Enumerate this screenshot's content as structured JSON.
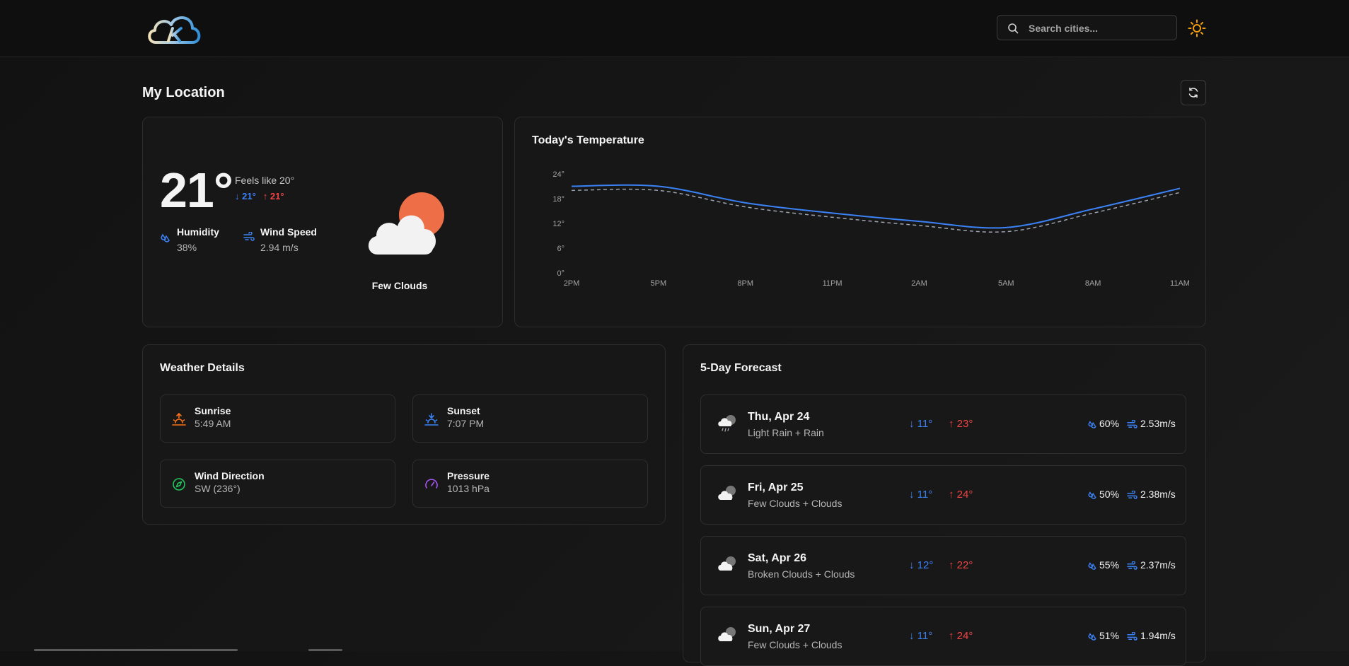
{
  "header": {
    "logo": "cloud-logo",
    "search_placeholder": "Search cities...",
    "theme_icon": "sun-icon"
  },
  "location": {
    "title": "My Location",
    "refresh_icon": "refresh-icon"
  },
  "current": {
    "temperature": "21°",
    "feels_like": "Feels like 20°",
    "min": "21°",
    "max": "21°",
    "humidity_label": "Humidity",
    "humidity_value": "38%",
    "wind_label": "Wind Speed",
    "wind_value": "2.94 m/s",
    "condition": "Few Clouds",
    "condition_icon": "few-clouds-icon"
  },
  "chart_data": {
    "type": "line",
    "title": "Today's Temperature",
    "categories": [
      "2PM",
      "5PM",
      "8PM",
      "11PM",
      "2AM",
      "5AM",
      "8AM",
      "11AM"
    ],
    "y_ticks": [
      "24°",
      "18°",
      "12°",
      "6°",
      "0°"
    ],
    "ylim": [
      0,
      24
    ],
    "grid": false,
    "series": [
      {
        "values": [
          21,
          21,
          17,
          14.5,
          12.5,
          11,
          15.5,
          20.5
        ],
        "color": "#3b82f6",
        "style": "solid"
      },
      {
        "values": [
          20,
          20,
          16,
          13.5,
          11.5,
          10,
          14.5,
          19.5
        ],
        "color": "#9ca3af",
        "style": "dashed"
      }
    ]
  },
  "details": {
    "title": "Weather Details",
    "items": [
      {
        "label": "Sunrise",
        "value": "5:49 AM",
        "icon": "sunrise-icon",
        "color": "#f97316"
      },
      {
        "label": "Sunset",
        "value": "7:07 PM",
        "icon": "sunset-icon",
        "color": "#3b82f6"
      },
      {
        "label": "Wind Direction",
        "value": "SW (236°)",
        "icon": "compass-icon",
        "color": "#22c55e"
      },
      {
        "label": "Pressure",
        "value": "1013 hPa",
        "icon": "gauge-icon",
        "color": "#a855f7"
      }
    ]
  },
  "forecast": {
    "title": "5-Day Forecast",
    "days": [
      {
        "day": "Thu, Apr 24",
        "desc": "Light Rain + Rain",
        "low": "11°",
        "high": "23°",
        "humidity": "60%",
        "wind": "2.53m/s",
        "icon": "rain-cloud-icon"
      },
      {
        "day": "Fri, Apr 25",
        "desc": "Few Clouds + Clouds",
        "low": "11°",
        "high": "24°",
        "humidity": "50%",
        "wind": "2.38m/s",
        "icon": "cloud-icon"
      },
      {
        "day": "Sat, Apr 26",
        "desc": "Broken Clouds + Clouds",
        "low": "12°",
        "high": "22°",
        "humidity": "55%",
        "wind": "2.37m/s",
        "icon": "cloud-icon"
      },
      {
        "day": "Sun, Apr 27",
        "desc": "Few Clouds + Clouds",
        "low": "11°",
        "high": "24°",
        "humidity": "51%",
        "wind": "1.94m/s",
        "icon": "cloud-icon"
      }
    ]
  }
}
